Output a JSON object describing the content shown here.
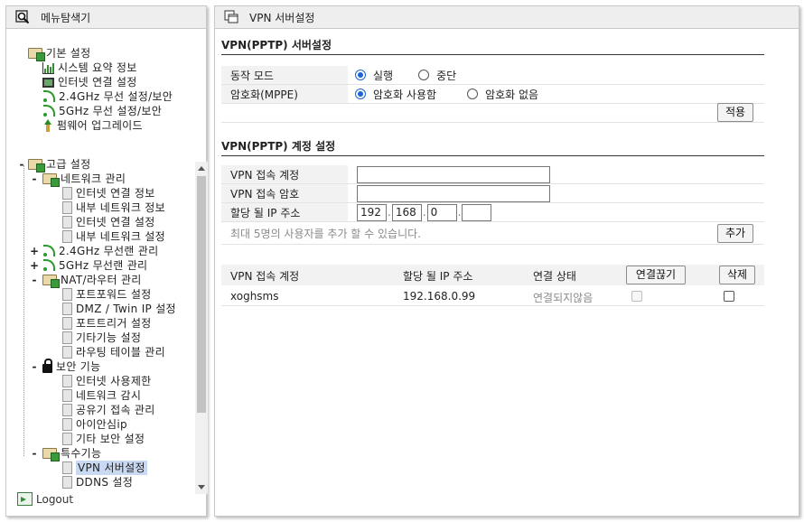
{
  "nav": {
    "header": "메뉴탐색기",
    "basic": {
      "label": "기본 설정",
      "items": [
        "시스템 요약 정보",
        "인터넷 연결 설정",
        "2.4GHz 무선 설정/보안",
        "5GHz 무선 설정/보안",
        "펌웨어 업그레이드"
      ]
    },
    "advanced": {
      "toggle": "-",
      "label": "고급 설정",
      "network": {
        "toggle": "-",
        "label": "네트워크 관리",
        "items": [
          "인터넷 연결 정보",
          "내부 네트워크 정보",
          "인터넷 연결 설정",
          "내부 네트워크 설정"
        ]
      },
      "wifi24": {
        "toggle": "+",
        "label": "2.4GHz 무선랜 관리"
      },
      "wifi5": {
        "toggle": "+",
        "label": "5GHz 무선랜 관리"
      },
      "nat": {
        "toggle": "-",
        "label": "NAT/라우터 관리",
        "items": [
          "포트포워드 설정",
          "DMZ / Twin IP 설정",
          "포트트리거 설정",
          "기타기능 설정",
          "라우팅 테이블 관리"
        ]
      },
      "security": {
        "toggle": "-",
        "label": "보안 기능",
        "items": [
          "인터넷 사용제한",
          "네트워크 감시",
          "공유기 접속 관리",
          "아이안심ip",
          "기타 보안 설정"
        ]
      },
      "special": {
        "toggle": "-",
        "label": "특수기능",
        "items": [
          "VPN 서버설정",
          "DDNS 설정"
        ]
      }
    },
    "logout": "Logout"
  },
  "content": {
    "header": "VPN 서버설정",
    "server": {
      "title": "VPN(PPTP) 서버설정",
      "mode_label": "동작 모드",
      "mode_options": [
        "실행",
        "중단"
      ],
      "mode_selected": "실행",
      "enc_label": "암호화(MPPE)",
      "enc_options": [
        "암호화 사용함",
        "암호화 없음"
      ],
      "enc_selected": "암호화 사용함",
      "apply": "적용"
    },
    "account": {
      "title": "VPN(PPTP) 계정 설정",
      "user_label": "VPN 접속 계정",
      "user_value": "",
      "pass_label": "VPN 접속 암호",
      "pass_value": "",
      "ip_label": "할당 될 IP 주소",
      "ip_parts": [
        "192",
        "168",
        "0",
        ""
      ],
      "note": "최대 5명의 사용자를 추가 할 수 있습니다.",
      "add": "추가"
    },
    "list": {
      "headers": [
        "VPN 접속 계정",
        "할당 될 IP 주소",
        "연결 상태"
      ],
      "disconnect": "연결끊기",
      "delete": "삭제",
      "rows": [
        {
          "account": "xoghsms",
          "ip": "192.168.0.99",
          "status": "연결되지않음"
        }
      ]
    }
  }
}
